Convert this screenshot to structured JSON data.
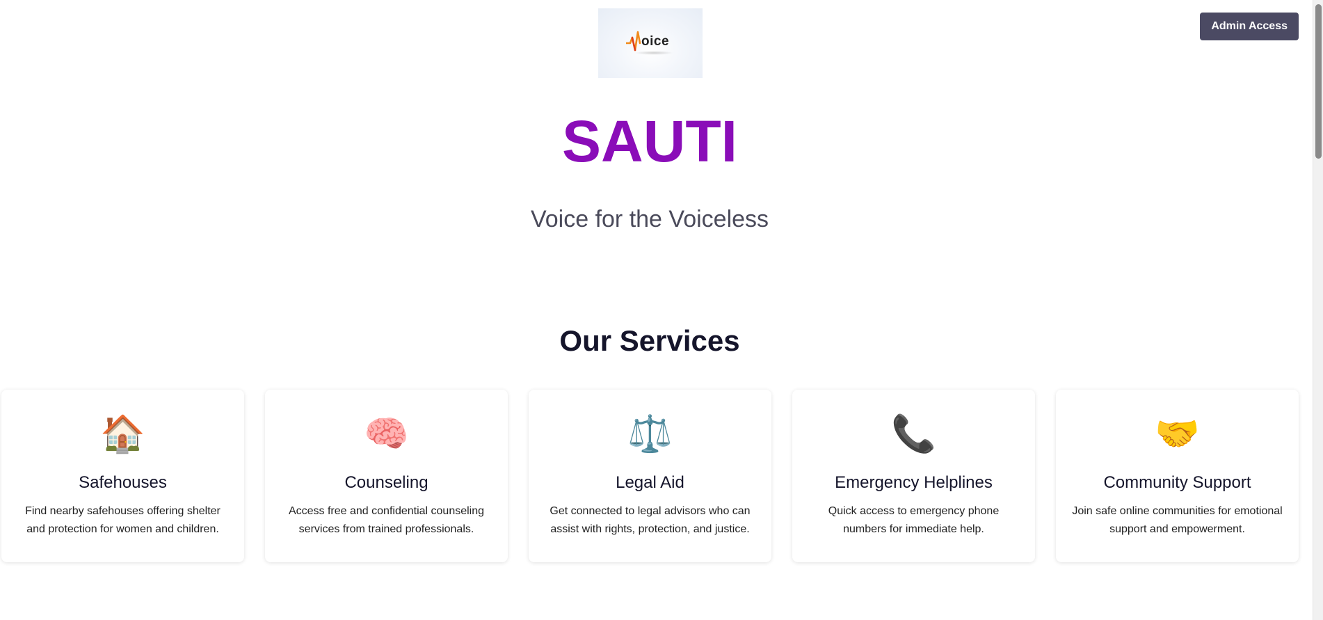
{
  "header": {
    "admin_button_label": "Admin Access",
    "logo_text": "oice"
  },
  "hero": {
    "title": "SAUTI",
    "tagline": "Voice for the Voiceless"
  },
  "services": {
    "heading": "Our Services",
    "cards": [
      {
        "icon": "🏠",
        "icon_name": "house-icon",
        "title": "Safehouses",
        "description": "Find nearby safehouses offering shelter and protection for women and children."
      },
      {
        "icon": "🧠",
        "icon_name": "brain-icon",
        "title": "Counseling",
        "description": "Access free and confidential counseling services from trained professionals."
      },
      {
        "icon": "⚖️",
        "icon_name": "scales-icon",
        "title": "Legal Aid",
        "description": "Get connected to legal advisors who can assist with rights, protection, and justice."
      },
      {
        "icon": "📞",
        "icon_name": "phone-icon",
        "title": "Emergency Helplines",
        "description": "Quick access to emergency phone numbers for immediate help."
      },
      {
        "icon": "🤝",
        "icon_name": "handshake-icon",
        "title": "Community Support",
        "description": "Join safe online communities for emotional support and empowerment."
      }
    ]
  },
  "colors": {
    "brand_purple": "#8a0db8",
    "admin_button_bg": "#4b4a63",
    "heading_dark": "#15152b",
    "tagline_gray": "#4a4a5a"
  }
}
